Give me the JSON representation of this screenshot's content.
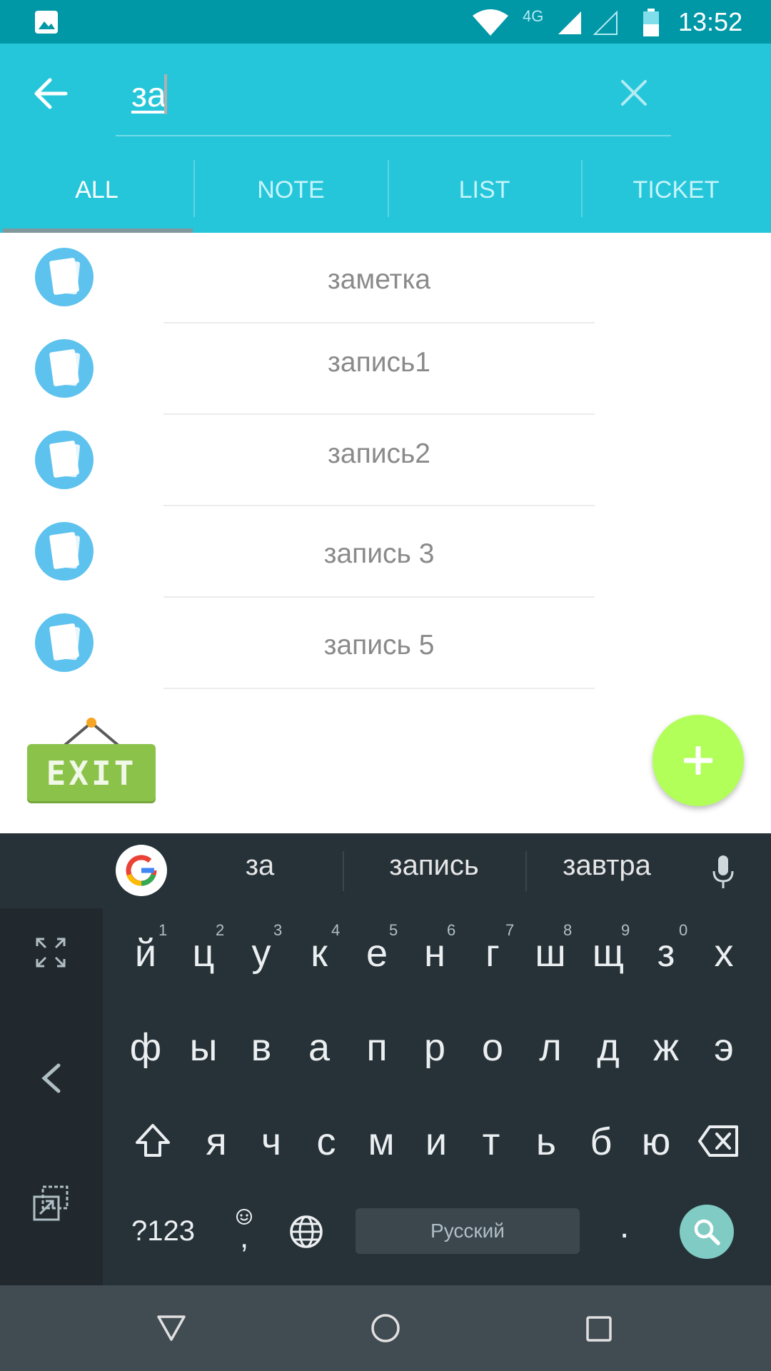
{
  "status_bar": {
    "network_label": "4G",
    "time": "13:52",
    "icons": [
      "image-icon",
      "wifi-icon",
      "signal-icon",
      "signal-empty-icon",
      "battery-icon"
    ]
  },
  "search": {
    "query": "за",
    "back_icon": "arrow-left-icon",
    "clear_icon": "close-icon"
  },
  "tabs": [
    {
      "label": "ALL",
      "active": true
    },
    {
      "label": "NOTE",
      "active": false
    },
    {
      "label": "LIST",
      "active": false
    },
    {
      "label": "TICKET",
      "active": false
    }
  ],
  "results": [
    {
      "title": "заметка"
    },
    {
      "title": "запись1"
    },
    {
      "title": "запись2"
    },
    {
      "title": "запись 3"
    },
    {
      "title": "запись 5"
    }
  ],
  "exit_sign": {
    "label": "EXIT"
  },
  "fab": {
    "icon": "plus-icon",
    "color": "#b2ff59"
  },
  "keyboard": {
    "suggestions": [
      "за",
      "запись",
      "завтра"
    ],
    "row1": [
      "й",
      "ц",
      "у",
      "к",
      "е",
      "н",
      "г",
      "ш",
      "щ",
      "з",
      "х"
    ],
    "row1_hints": [
      "1",
      "2",
      "3",
      "4",
      "5",
      "6",
      "7",
      "8",
      "9",
      "0"
    ],
    "row2": [
      "ф",
      "ы",
      "в",
      "а",
      "п",
      "р",
      "о",
      "л",
      "д",
      "ж",
      "э"
    ],
    "row3": [
      "я",
      "ч",
      "с",
      "м",
      "и",
      "т",
      "ь",
      "б",
      "ю"
    ],
    "symbols_label": "?123",
    "comma_label": ",",
    "period_label": ".",
    "space_label": "Русский"
  },
  "colors": {
    "status_bar": "#0097a7",
    "app_bar": "#26c6da",
    "note_icon": "#5dc2ee",
    "exit_green": "#8bc34a",
    "keyboard_bg": "#263238",
    "search_key": "#80cbc4",
    "nav_bar": "#414b52"
  }
}
